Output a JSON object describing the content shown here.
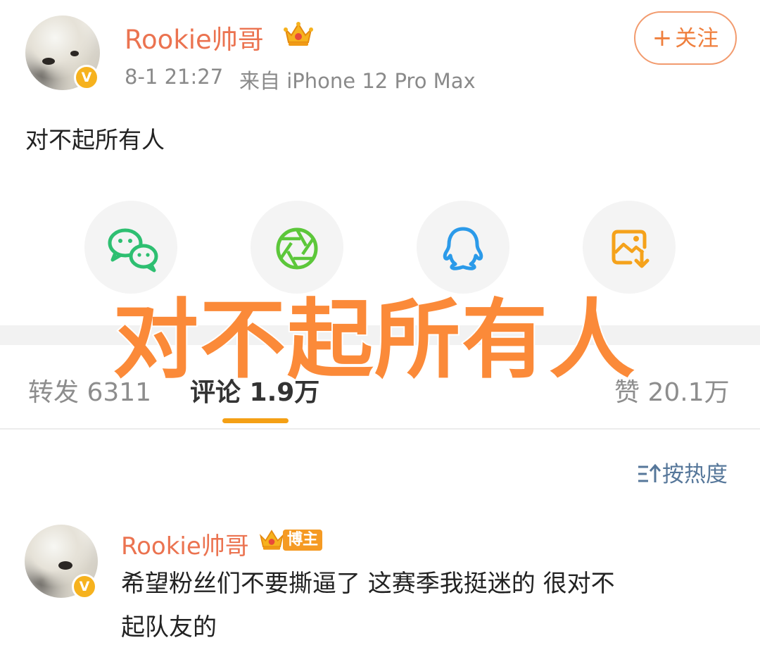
{
  "post": {
    "author": "Rookie帅哥",
    "timestamp": "8-1 21:27",
    "source": "来自 iPhone 12 Pro Max",
    "verified_mark": "V",
    "text": "对不起所有人"
  },
  "follow_button": {
    "label": "关注"
  },
  "share_targets": [
    {
      "name": "WeChat",
      "icon": "wechat-icon",
      "color": "#2ebf71"
    },
    {
      "name": "Moments",
      "icon": "moments-aperture-icon",
      "color": "#5cc73a"
    },
    {
      "name": "QQ",
      "icon": "qq-penguin-icon",
      "color": "#2b9ae9"
    },
    {
      "name": "Save Image",
      "icon": "save-image-icon",
      "color": "#f5a21b"
    }
  ],
  "overlay_caption": "对不起所有人",
  "stats_tabs": {
    "repost": "转发 6311",
    "comments": "评论 1.9万",
    "likes": "赞 20.1万"
  },
  "sort": {
    "label": "按热度"
  },
  "comment": {
    "author": "Rookie帅哥",
    "badge": "博主",
    "verified_mark": "V",
    "text_line1": "希望粉丝们不要撕逼了 这赛季我挺迷的 很对不",
    "text_line2": "起队友的"
  },
  "colors": {
    "name_orange": "#eb7350",
    "accent_tab": "#f4a015",
    "overlay_orange": "#fb8a39",
    "link_blue": "#56779a"
  }
}
